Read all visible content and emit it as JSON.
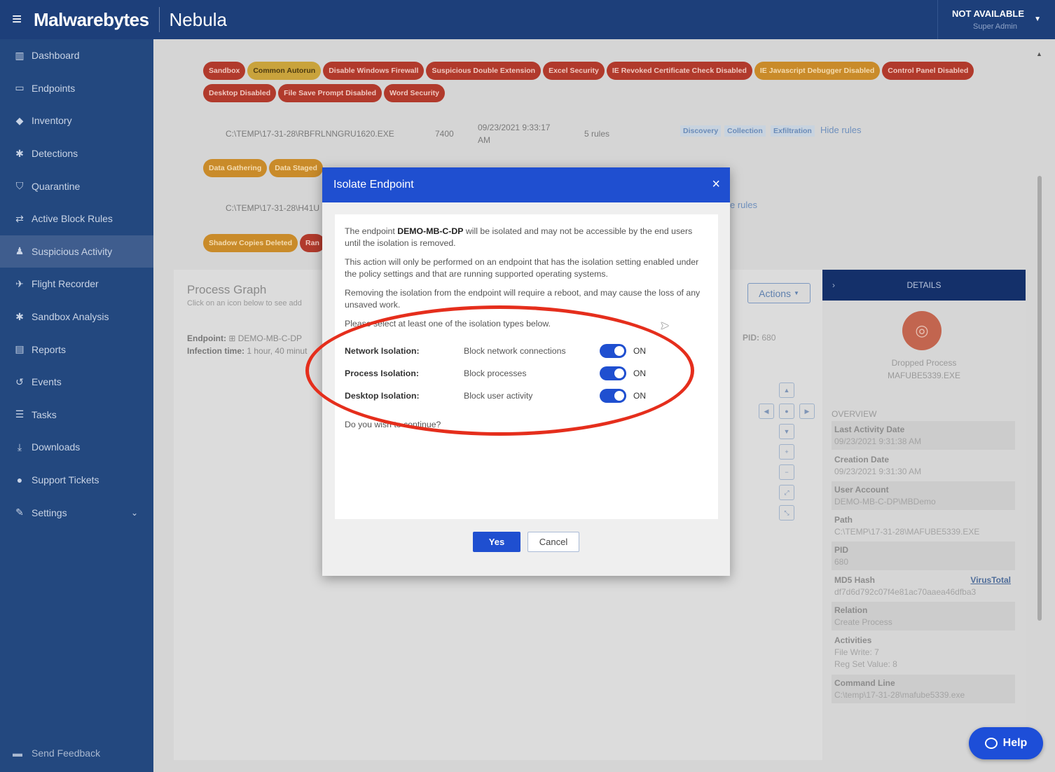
{
  "header": {
    "brand": "Malwarebytes",
    "product": "Nebula",
    "account_name": "NOT AVAILABLE",
    "account_role": "Super Admin"
  },
  "sidebar": {
    "items": [
      {
        "label": "Dashboard",
        "icon": "bar-chart-icon"
      },
      {
        "label": "Endpoints",
        "icon": "monitor-icon"
      },
      {
        "label": "Inventory",
        "icon": "tag-icon"
      },
      {
        "label": "Detections",
        "icon": "bug-icon"
      },
      {
        "label": "Quarantine",
        "icon": "shield-icon"
      },
      {
        "label": "Active Block Rules",
        "icon": "swap-arrows-icon"
      },
      {
        "label": "Suspicious Activity",
        "icon": "person-icon"
      },
      {
        "label": "Flight Recorder",
        "icon": "paper-plane-icon"
      },
      {
        "label": "Sandbox Analysis",
        "icon": "bug-icon"
      },
      {
        "label": "Reports",
        "icon": "document-icon"
      },
      {
        "label": "Events",
        "icon": "history-icon"
      },
      {
        "label": "Tasks",
        "icon": "list-icon"
      },
      {
        "label": "Downloads",
        "icon": "download-icon"
      },
      {
        "label": "Support Tickets",
        "icon": "chat-icon"
      },
      {
        "label": "Settings",
        "icon": "wrench-icon"
      }
    ],
    "feedback": "Send Feedback"
  },
  "background": {
    "tags_row1": [
      "Sandbox",
      "Common Autorun",
      "Disable Windows Firewall",
      "Suspicious Double Extension",
      "Excel Security",
      "IE Revoked Certificate Check Disabled",
      "IE Javascript Debugger Disabled",
      "Control Panel Disabled"
    ],
    "tags_row2": [
      "Desktop Disabled",
      "File Save Prompt Disabled",
      "Word Security"
    ],
    "tags_row3": [
      "Data Gathering",
      "Data Staged"
    ],
    "tags_row4": [
      "Shadow Copies Deleted",
      "Ran"
    ],
    "proc1": {
      "path": "C:\\TEMP\\17-31-28\\RBFRLNNGRU1620.EXE",
      "pid": "7400",
      "date": "09/23/2021 9:33:17",
      "date2": "AM",
      "rules": "5 rules"
    },
    "proc2": {
      "path": "C:\\TEMP\\17-31-28\\H41U",
      "rules": "e rules"
    },
    "mitre": [
      "Discovery",
      "Collection",
      "Exfiltration"
    ],
    "hide_rules": "Hide rules",
    "process_graph_title": "Process Graph",
    "process_graph_sub": "Click on an icon below to see add",
    "endpoint_label": "Endpoint:",
    "endpoint_value": "DEMO-MB-C-DP",
    "infection_label": "Infection time:",
    "infection_value": "1 hour, 40 minut",
    "pid_label": "PID:",
    "pid_value": "680",
    "actions_label": "Actions"
  },
  "details": {
    "title": "DETAILS",
    "process_type": "Dropped Process",
    "process_name": "MAFUBE5339.EXE",
    "overview": "OVERVIEW",
    "rows": [
      {
        "key": "Last Activity Date",
        "value": "09/23/2021 9:31:38 AM"
      },
      {
        "key": "Creation Date",
        "value": "09/23/2021 9:31:30 AM"
      },
      {
        "key": "User Account",
        "value": "DEMO-MB-C-DP\\MBDemo"
      },
      {
        "key": "Path",
        "value": "C:\\TEMP\\17-31-28\\MAFUBE5339.EXE"
      },
      {
        "key": "PID",
        "value": "680"
      },
      {
        "key": "MD5 Hash",
        "value": "df7d6d792c07f4e81ac70aaea46dfba3",
        "link": "VirusTotal"
      },
      {
        "key": "Relation",
        "value": "Create Process"
      },
      {
        "key": "Activities",
        "value": "File Write: 7",
        "value2": "Reg Set Value: 8"
      },
      {
        "key": "Command Line",
        "value": "C:\\temp\\17-31-28\\mafube5339.exe"
      }
    ]
  },
  "modal": {
    "title": "Isolate Endpoint",
    "intro_pre": "The endpoint ",
    "endpoint": "DEMO-MB-C-DP",
    "intro_post": " will be isolated and may not be accessible by the end users until the isolation is removed.",
    "para2": "This action will only be performed on an endpoint that has the isolation setting enabled under the policy settings and that are running supported operating systems.",
    "para3": "Removing the isolation from the endpoint will require a reboot, and may cause the loss of any unsaved work.",
    "para4": "Please select at least one of the isolation types below.",
    "isolations": [
      {
        "label": "Network Isolation:",
        "desc": "Block network connections",
        "state": "ON"
      },
      {
        "label": "Process Isolation:",
        "desc": "Block processes",
        "state": "ON"
      },
      {
        "label": "Desktop Isolation:",
        "desc": "Block user activity",
        "state": "ON"
      }
    ],
    "question": "Do you wish to continue?",
    "yes": "Yes",
    "cancel": "Cancel"
  },
  "help": "Help",
  "colors": {
    "header_bg": "#1d3f7a",
    "sidebar_bg": "#23487f",
    "modal_primary": "#1f4fd0",
    "annotation": "#e52e1c"
  }
}
